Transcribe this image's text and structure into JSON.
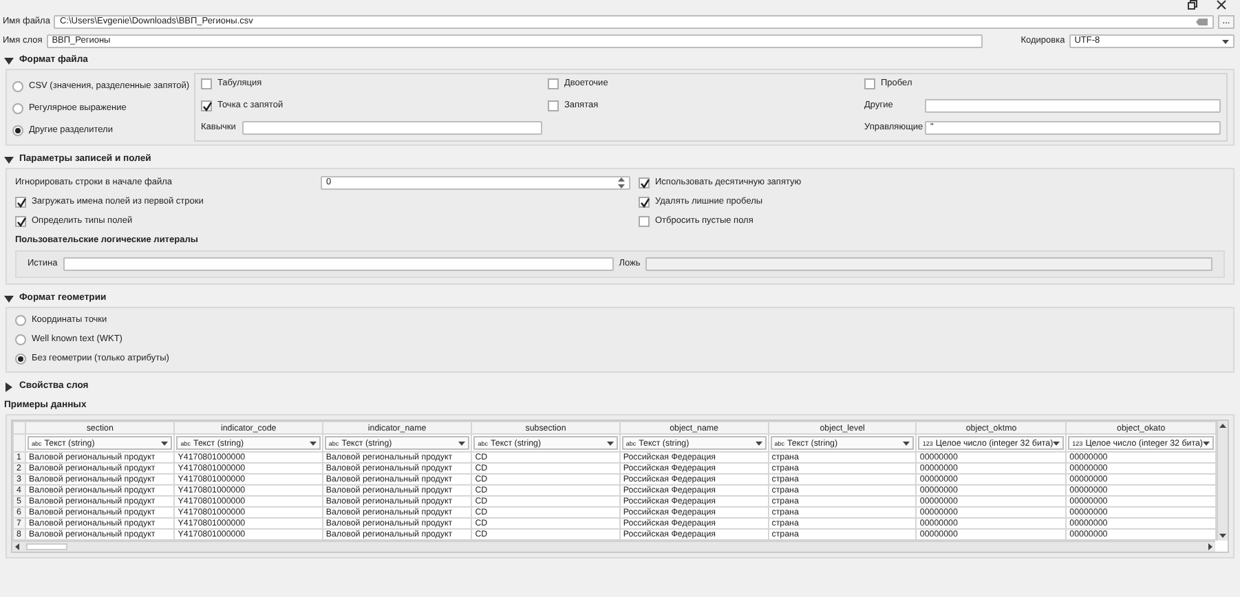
{
  "file": {
    "label": "Имя файла",
    "value": "C:\\Users\\Evgenie\\Downloads\\ВВП_Регионы.csv",
    "browse": "..."
  },
  "layer": {
    "label": "Имя слоя",
    "value": "ВВП_Регионы"
  },
  "encoding": {
    "label": "Кодировка",
    "value": "UTF-8"
  },
  "file_format": {
    "title": "Формат файла",
    "expanded": true,
    "formats": [
      {
        "label": "CSV (значения, разделенные запятой)",
        "selected": false
      },
      {
        "label": "Регулярное выражение",
        "selected": false
      },
      {
        "label": "Другие разделители",
        "selected": true
      }
    ],
    "delimiters": [
      {
        "label": "Табуляция",
        "checked": false
      },
      {
        "label": "Двоеточие",
        "checked": false
      },
      {
        "label": "Пробел",
        "checked": false
      },
      {
        "label": "Точка с запятой",
        "checked": true
      },
      {
        "label": "Запятая",
        "checked": false
      }
    ],
    "others": {
      "label": "Другие"
    },
    "quote": {
      "label": "Кавычки"
    },
    "escape": {
      "label": "Управляющие",
      "value": "\""
    }
  },
  "records": {
    "title": "Параметры записей и полей",
    "expanded": true,
    "skip": {
      "label": "Игнорировать строки в начале файла",
      "value": "0"
    },
    "left_checks": [
      {
        "label": "Загружать имена полей из первой строки",
        "checked": true
      },
      {
        "label": "Определить типы полей",
        "checked": true
      }
    ],
    "right_checks": [
      {
        "label": "Использовать десятичную запятую",
        "checked": true
      },
      {
        "label": "Удалять лишние пробелы",
        "checked": true
      },
      {
        "label": "Отбросить пустые поля",
        "checked": false
      }
    ],
    "literals": {
      "title": "Пользовательские логические литералы",
      "true_label": "Истина",
      "false_label": "Ложь",
      "false_disabled": true
    }
  },
  "geometry": {
    "title": "Формат геометрии",
    "expanded": true,
    "options": [
      {
        "label": "Координаты точки",
        "selected": false
      },
      {
        "label": "Well known text (WKT)",
        "selected": false
      },
      {
        "label": "Без геометрии (только атрибуты)",
        "selected": true
      }
    ]
  },
  "layer_properties": {
    "title": "Свойства слоя",
    "expanded": false
  },
  "sample": {
    "title": "Примеры данных",
    "columns": [
      {
        "name": "section",
        "type_icon": "abc",
        "type": "Текст (string)"
      },
      {
        "name": "indicator_code",
        "type_icon": "abc",
        "type": "Текст (string)"
      },
      {
        "name": "indicator_name",
        "type_icon": "abc",
        "type": "Текст (string)"
      },
      {
        "name": "subsection",
        "type_icon": "abc",
        "type": "Текст (string)"
      },
      {
        "name": "object_name",
        "type_icon": "abc",
        "type": "Текст (string)"
      },
      {
        "name": "object_level",
        "type_icon": "abc",
        "type": "Текст (string)"
      },
      {
        "name": "object_oktmo",
        "type_icon": "123",
        "type": "Целое число (integer 32 бита)"
      },
      {
        "name": "object_okato",
        "type_icon": "123",
        "type": "Целое число (integer 32 бита)"
      }
    ],
    "rows": [
      {
        "number": "1",
        "cells": [
          "Валовой региональный продукт",
          "Y4170801000000",
          "Валовой региональный продукт",
          "CD",
          "Российская Федерация",
          "страна",
          "00000000",
          "00000000"
        ]
      },
      {
        "number": "2",
        "cells": [
          "Валовой региональный продукт",
          "Y4170801000000",
          "Валовой региональный продукт",
          "CD",
          "Российская Федерация",
          "страна",
          "00000000",
          "00000000"
        ]
      },
      {
        "number": "3",
        "cells": [
          "Валовой региональный продукт",
          "Y4170801000000",
          "Валовой региональный продукт",
          "CD",
          "Российская Федерация",
          "страна",
          "00000000",
          "00000000"
        ]
      },
      {
        "number": "4",
        "cells": [
          "Валовой региональный продукт",
          "Y4170801000000",
          "Валовой региональный продукт",
          "CD",
          "Российская Федерация",
          "страна",
          "00000000",
          "00000000"
        ]
      },
      {
        "number": "5",
        "cells": [
          "Валовой региональный продукт",
          "Y4170801000000",
          "Валовой региональный продукт",
          "CD",
          "Российская Федерация",
          "страна",
          "00000000",
          "00000000"
        ]
      },
      {
        "number": "6",
        "cells": [
          "Валовой региональный продукт",
          "Y4170801000000",
          "Валовой региональный продукт",
          "CD",
          "Российская Федерация",
          "страна",
          "00000000",
          "00000000"
        ]
      },
      {
        "number": "7",
        "cells": [
          "Валовой региональный продукт",
          "Y4170801000000",
          "Валовой региональный продукт",
          "CD",
          "Российская Федерация",
          "страна",
          "00000000",
          "00000000"
        ]
      },
      {
        "number": "8",
        "cells": [
          "Валовой региональный продукт",
          "Y4170801000000",
          "Валовой региональный продукт",
          "CD",
          "Российская Федерация",
          "страна",
          "00000000",
          "00000000"
        ]
      }
    ]
  }
}
